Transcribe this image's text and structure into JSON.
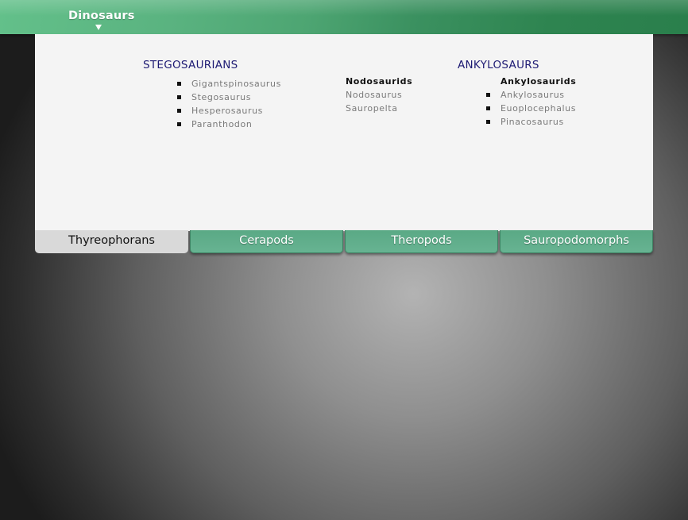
{
  "menu": {
    "title": "Dinosaurs"
  },
  "panel": {
    "stegosaurians": {
      "title": "STEGOSAURIANS",
      "items": [
        "Gigantspinosaurus",
        "Stegosaurus",
        "Hesperosaurus",
        "Paranthodon"
      ]
    },
    "ankylosaurs": {
      "title": "ANKYLOSAURS",
      "nodosaurids": {
        "title": "Nodosaurids",
        "items": [
          "Nodosaurus",
          "Sauropelta"
        ]
      },
      "ankylosaurids": {
        "title": "Ankylosaurids",
        "items": [
          "Ankylosaurus",
          "Euoplocephalus",
          "Pinacosaurus"
        ]
      }
    }
  },
  "tabs": [
    {
      "label": "Thyreophorans",
      "active": true
    },
    {
      "label": "Cerapods",
      "active": false
    },
    {
      "label": "Theropods",
      "active": false
    },
    {
      "label": "Sauropodomorphs",
      "active": false
    }
  ],
  "colors": {
    "bar_green": "#2e8450",
    "tab_green": "#5aa985",
    "heading_navy": "#1d1a73"
  }
}
